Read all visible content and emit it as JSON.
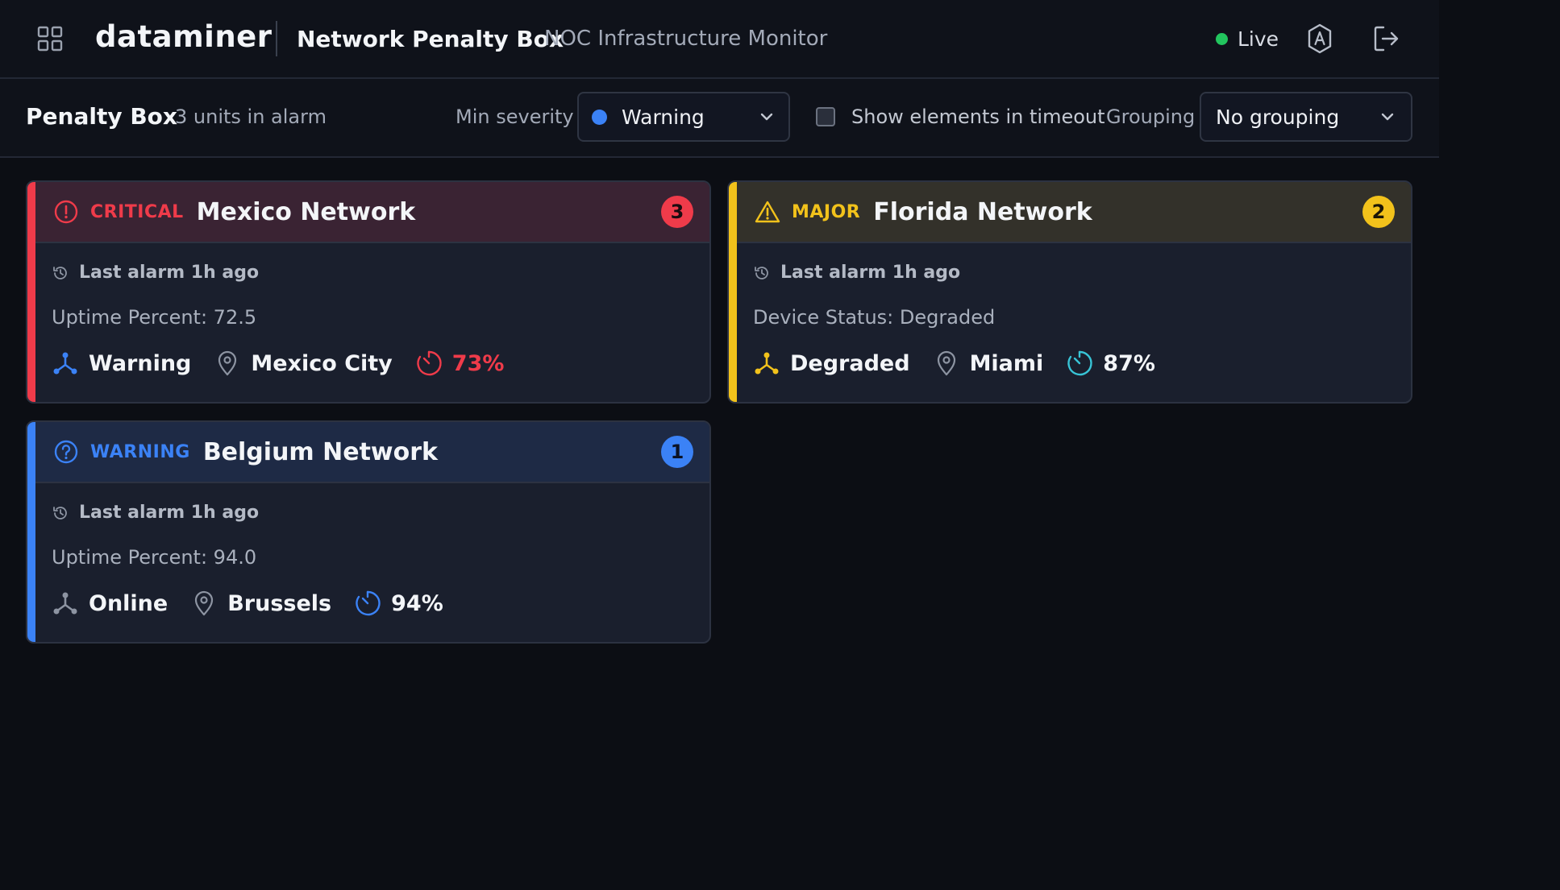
{
  "header": {
    "brand": "dataminer",
    "title": "Network Penalty Box",
    "subtitle": "NOC Infrastructure Monitor",
    "live_label": "Live",
    "icons": [
      "apps-grid-icon",
      "settings-gear-icon",
      "logout-icon"
    ]
  },
  "toolbar": {
    "title": "Penalty Box",
    "count_text": "3 units in alarm",
    "min_severity_label": "Min severity",
    "min_severity_value": "Warning",
    "show_timeout_label": "Show elements in timeout",
    "show_timeout_checked": false,
    "grouping_label": "Grouping",
    "grouping_value": "No grouping"
  },
  "colors": {
    "critical": "#ef3b4a",
    "major": "#f2c21b",
    "warning": "#3b82f6",
    "live": "#22c55e",
    "teal": "#38c4d6"
  },
  "cards": [
    {
      "severity": "CRITICAL",
      "name": "Mexico Network",
      "count": "3",
      "last_alarm": "Last alarm 1h ago",
      "metric": "Uptime Percent: 72.5",
      "status": "Warning",
      "location": "Mexico City",
      "percent": "73%",
      "icon": "alert-circle-icon"
    },
    {
      "severity": "MAJOR",
      "name": "Florida Network",
      "count": "2",
      "last_alarm": "Last alarm 1h ago",
      "metric": "Device Status: Degraded",
      "status": "Degraded",
      "location": "Miami",
      "percent": "87%",
      "icon": "warning-triangle-icon"
    },
    {
      "severity": "WARNING",
      "name": "Belgium Network",
      "count": "1",
      "last_alarm": "Last alarm 1h ago",
      "metric": "Uptime Percent: 94.0",
      "status": "Online",
      "location": "Brussels",
      "percent": "94%",
      "icon": "question-circle-icon"
    }
  ]
}
